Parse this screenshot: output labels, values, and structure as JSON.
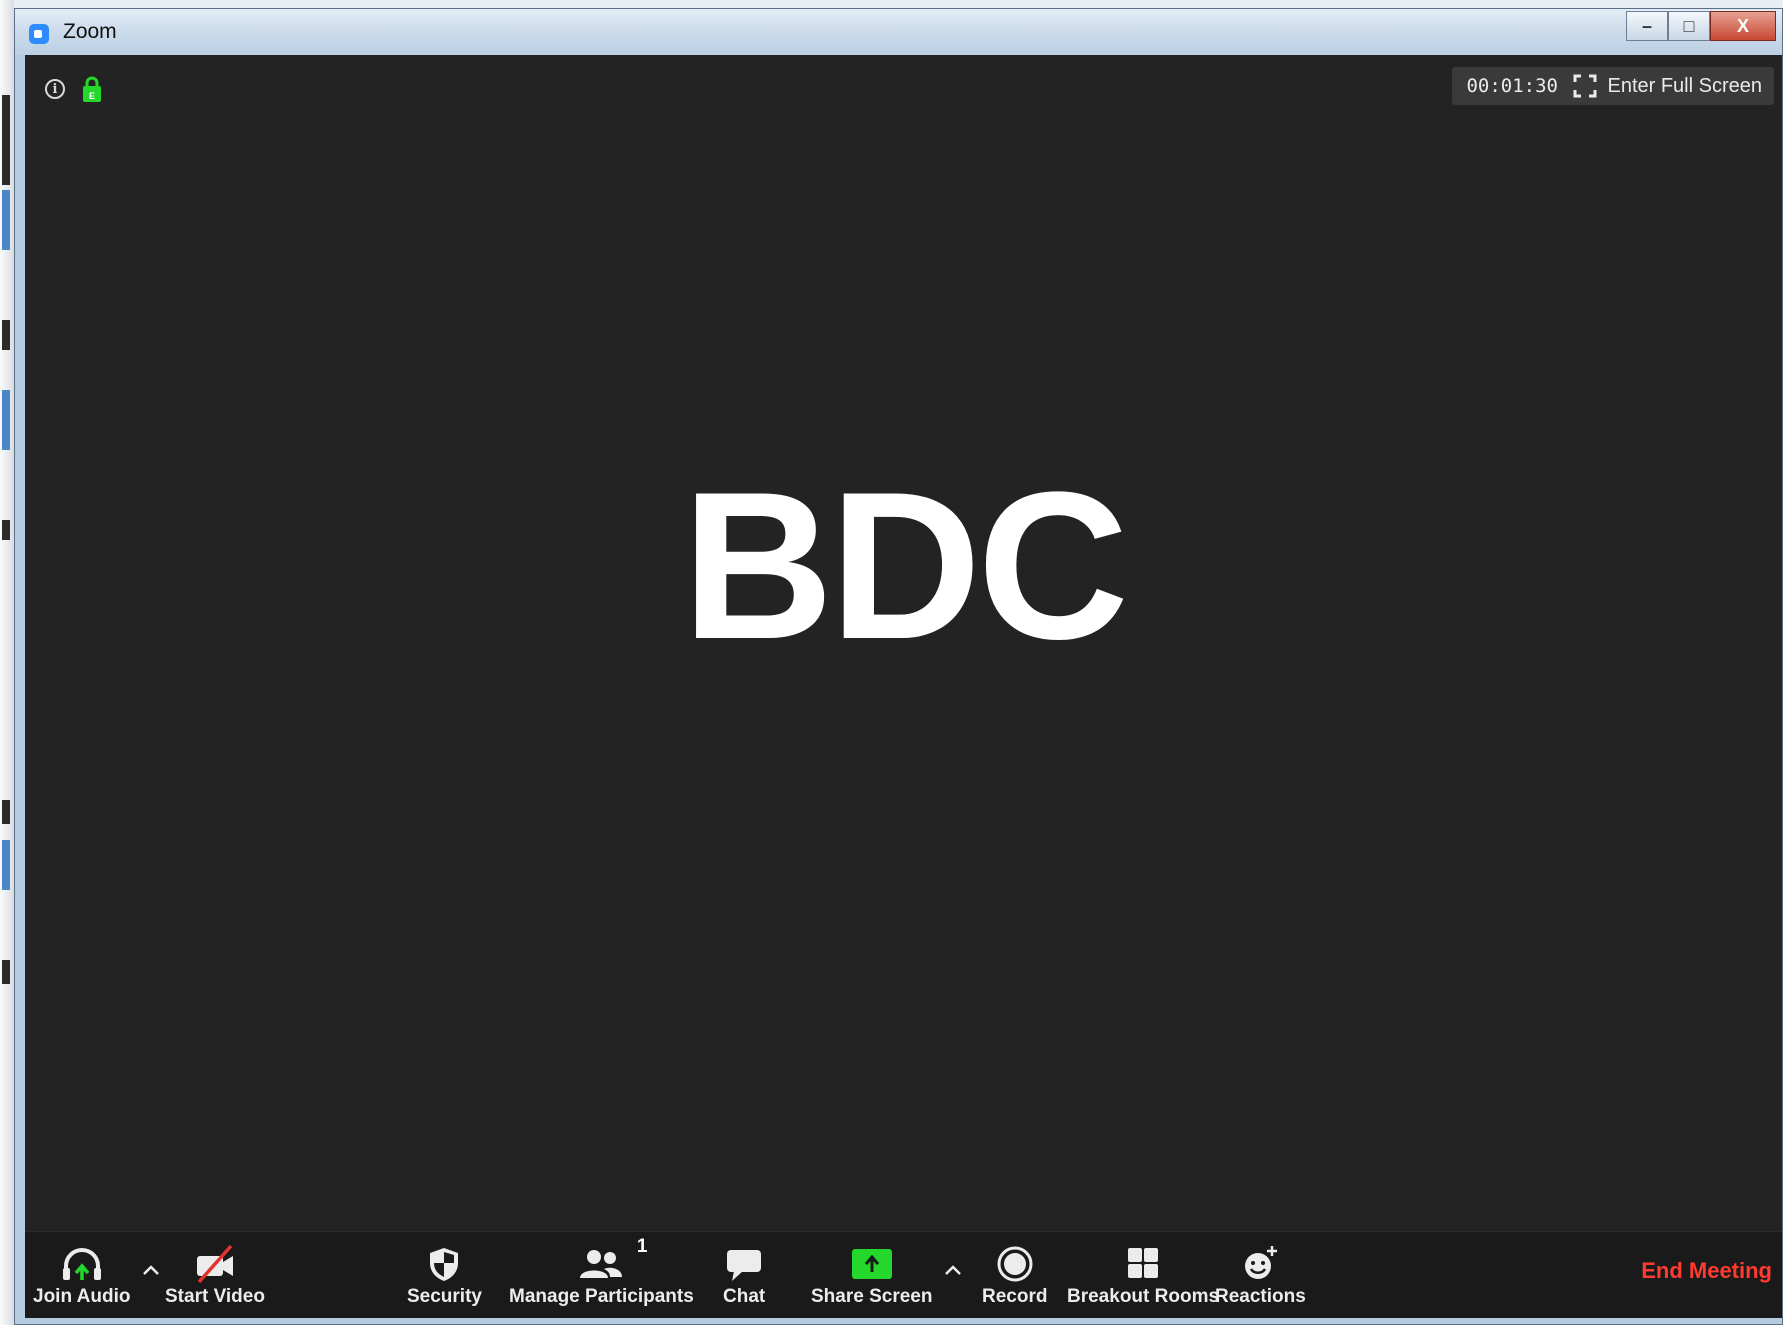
{
  "window": {
    "title": "Zoom",
    "controls": {
      "minimize": "–",
      "maximize": "□",
      "close": "X"
    }
  },
  "meeting": {
    "timer": "00:01:30",
    "fullscreen_label": "Enter Full Screen",
    "display_name": "BDC",
    "lock_badge": "E"
  },
  "toolbar": {
    "join_audio": "Join Audio",
    "start_video": "Start Video",
    "security": "Security",
    "participants": "Manage Participants",
    "participants_count": "1",
    "chat": "Chat",
    "share_screen": "Share Screen",
    "record": "Record",
    "breakout_rooms": "Breakout Rooms",
    "reactions": "Reactions",
    "end_meeting": "End Meeting"
  },
  "colors": {
    "accent_green": "#23d82a",
    "end_meeting_red": "#ff3b30",
    "background": "#232323"
  },
  "icons": {
    "app": "zoom-app-icon",
    "info": "info-icon",
    "lock": "lock-icon",
    "fullscreen": "fullscreen-icon",
    "audio": "headphones-icon",
    "video": "video-off-icon",
    "security": "shield-icon",
    "participants": "people-icon",
    "chat": "chat-bubble-icon",
    "share": "share-screen-icon",
    "record": "record-icon",
    "breakout": "grid-icon",
    "reactions": "smiley-icon"
  }
}
